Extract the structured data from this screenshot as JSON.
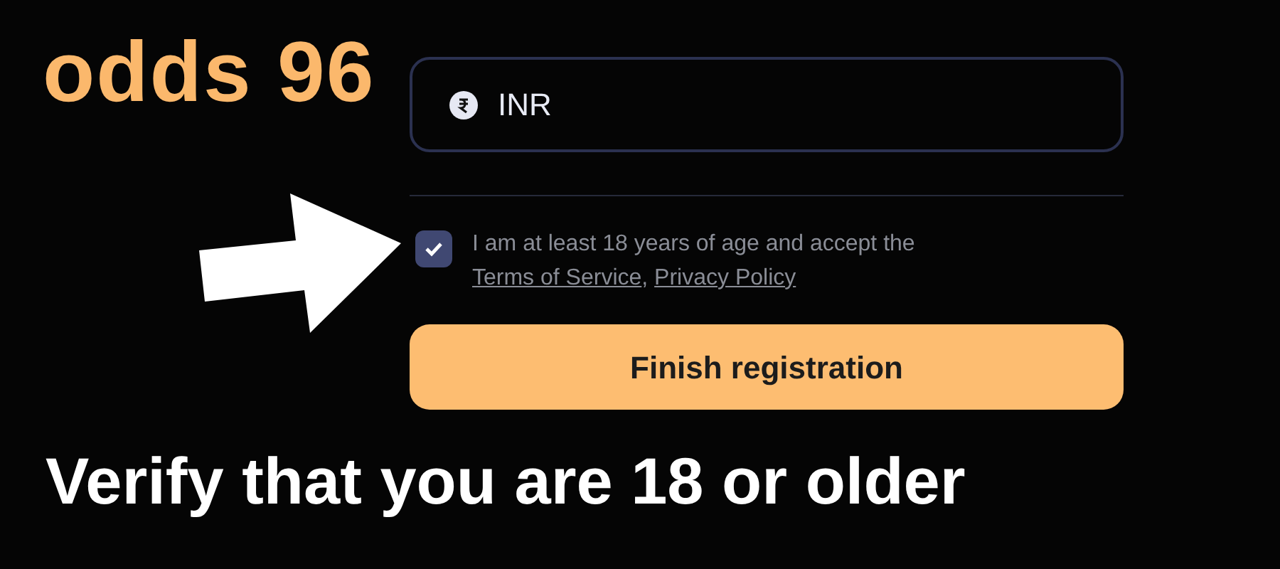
{
  "logo": {
    "text": "odds 96"
  },
  "currency_field": {
    "value": "INR"
  },
  "age_confirmation": {
    "checked": true,
    "text": "I am at least 18 years of age and accept the",
    "links": [
      "Terms of Service",
      "Privacy Policy"
    ],
    "separator": ","
  },
  "submit_button": {
    "label": "Finish registration"
  },
  "caption": "Verify that you are 18 or older"
}
